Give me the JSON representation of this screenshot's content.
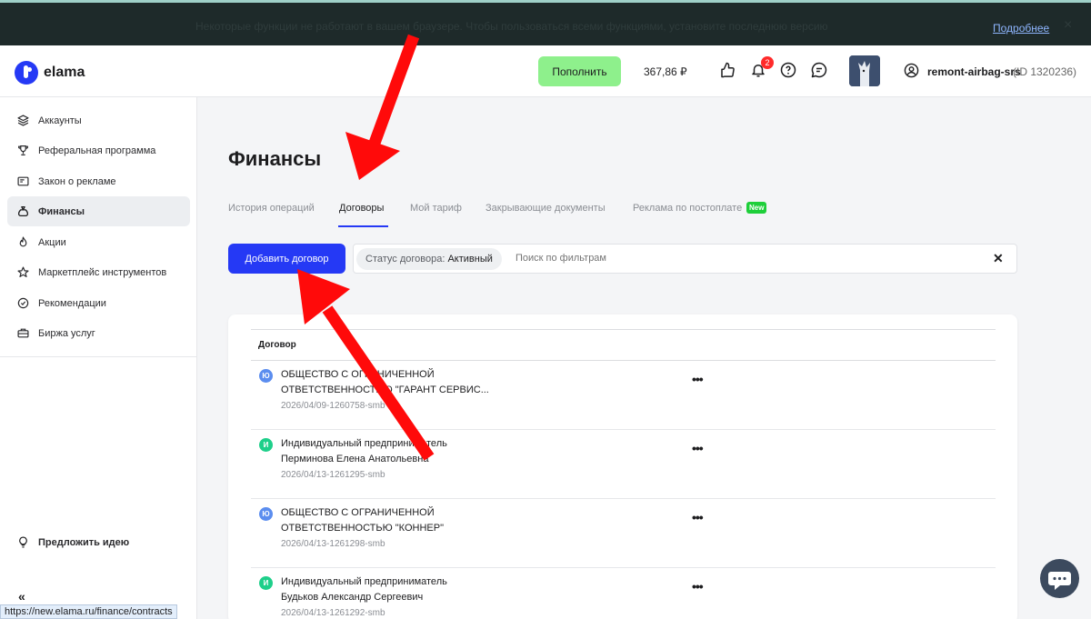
{
  "banner": {
    "text": "Некоторые функции не работают в вашем браузере. Чтобы пользоваться всеми функциями, установите последнюю версию",
    "link": "Подробнее",
    "close": "×"
  },
  "header": {
    "logo_text": "elama",
    "topup_label": "Пополнить",
    "balance": "367,86 ₽",
    "notifications_count": "2",
    "username": "remont-airbag-srs",
    "user_id": "(ID 1320236)"
  },
  "sidebar": {
    "items": [
      {
        "label": "Аккаунты",
        "icon": "layers-icon"
      },
      {
        "label": "Реферальная программа",
        "icon": "trophy-icon"
      },
      {
        "label": "Закон о рекламе",
        "icon": "ad-law-icon"
      },
      {
        "label": "Финансы",
        "icon": "money-bag-icon",
        "active": true
      },
      {
        "label": "Акции",
        "icon": "fire-icon"
      },
      {
        "label": "Маркетплейс инструментов",
        "icon": "star-icon"
      },
      {
        "label": "Рекомендации",
        "icon": "check-circle-icon"
      },
      {
        "label": "Биржа услуг",
        "icon": "briefcase-icon"
      }
    ],
    "suggest_idea": "Предложить идею",
    "collapse": "«"
  },
  "page": {
    "title": "Финансы",
    "tabs": [
      {
        "label": "История операций"
      },
      {
        "label": "Договоры",
        "active": true
      },
      {
        "label": "Мой тариф"
      },
      {
        "label": "Закрывающие документы"
      },
      {
        "label": "Реклама по постоплате"
      }
    ],
    "new_badge": "New",
    "add_contract_label": "Добавить договор",
    "filter_chip_key": "Статус договора:",
    "filter_chip_value": "Активный",
    "filter_placeholder": "Поиск по фильтрам",
    "filter_clear": "✕"
  },
  "table": {
    "header": "Договор",
    "rows": [
      {
        "type_letter": "Ю",
        "type_color": "#5b8def",
        "line1": "ОБЩЕСТВО С ОГРАНИЧЕННОЙ",
        "line2": "ОТВЕТСТВЕННОСТЬЮ \"ГАРАНТ СЕРВИС...",
        "number": "2026/04/09-1260758-smb"
      },
      {
        "type_letter": "И",
        "type_color": "#1ecf8a",
        "line1": "Индивидуальный предприниматель",
        "line2": "Перминова Елена Анатольевна",
        "number": "2026/04/13-1261295-smb"
      },
      {
        "type_letter": "Ю",
        "type_color": "#5b8def",
        "line1": "ОБЩЕСТВО С ОГРАНИЧЕННОЙ",
        "line2": "ОТВЕТСТВЕННОСТЬЮ \"КОННЕР\"",
        "number": "2026/04/13-1261298-smb"
      },
      {
        "type_letter": "И",
        "type_color": "#1ecf8a",
        "line1": "Индивидуальный предприниматель",
        "line2": "Будьков Александр Сергеевич",
        "number": "2026/04/13-1261292-smb"
      }
    ],
    "row_menu": "•••"
  },
  "status_bar_url": "https://new.elama.ru/finance/contracts",
  "colors": {
    "accent": "#2539f5",
    "topup": "#8ef08c",
    "annotation_arrow": "#ff0a0a"
  }
}
